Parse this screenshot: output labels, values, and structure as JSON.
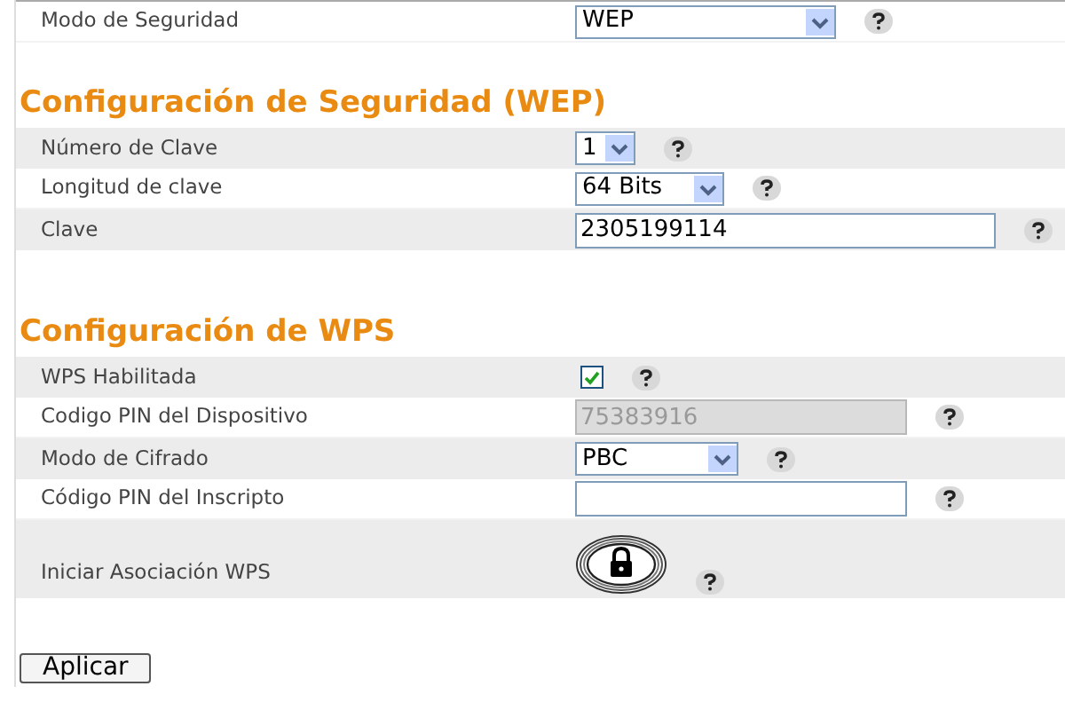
{
  "sections": [
    {
      "rows": [
        {
          "kind": "select",
          "label": "Modo de Seguridad",
          "value": "WEP"
        }
      ]
    },
    {
      "title": "Configuración de Seguridad (WEP)",
      "rows": [
        {
          "kind": "select",
          "label": "Número de Clave",
          "value": "1"
        },
        {
          "kind": "select",
          "label": "Longitud de clave",
          "value": "64 Bits"
        },
        {
          "kind": "input",
          "label": "Clave",
          "value": "2305199114",
          "disabled": false
        }
      ]
    },
    {
      "title": "Configuración de WPS",
      "rows": [
        {
          "kind": "checkbox",
          "label": "WPS Habilitada",
          "checked": true
        },
        {
          "kind": "input",
          "label": "Codigo PIN del Dispositivo",
          "value": "75383916",
          "disabled": true
        },
        {
          "kind": "select",
          "label": "Modo de Cifrado",
          "value": "PBC"
        },
        {
          "kind": "input",
          "label": "Código PIN del Inscripto",
          "disabled": false
        },
        {
          "kind": "wps_button",
          "label": "Iniciar Asociación WPS"
        }
      ]
    }
  ],
  "apply_button": "Aplicar"
}
